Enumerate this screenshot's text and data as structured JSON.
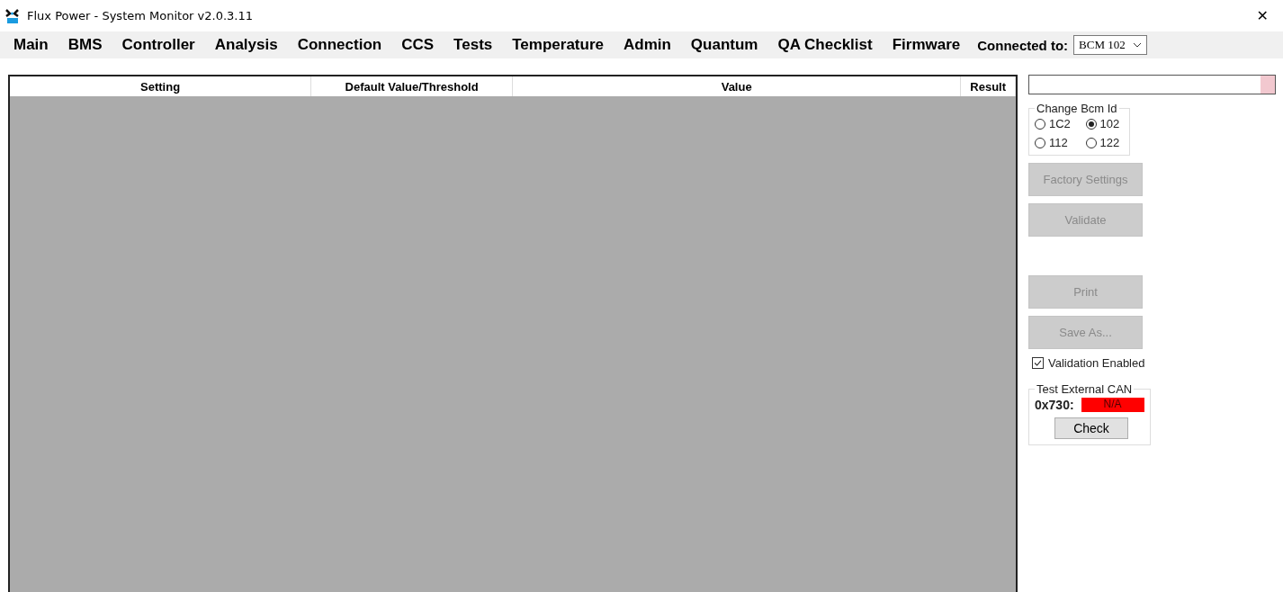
{
  "window": {
    "title": "Flux Power - System Monitor v2.0.3.11",
    "close": "✕"
  },
  "menu": [
    {
      "label": "Main"
    },
    {
      "label": "BMS"
    },
    {
      "label": "Controller"
    },
    {
      "label": "Analysis"
    },
    {
      "label": "Connection"
    },
    {
      "label": "CCS"
    },
    {
      "label": "Tests"
    },
    {
      "label": "Temperature"
    },
    {
      "label": "Admin"
    },
    {
      "label": "Quantum"
    },
    {
      "label": "QA Checklist"
    },
    {
      "label": "Firmware"
    }
  ],
  "connection": {
    "label": "Connected to:",
    "value": "BCM 102"
  },
  "table": {
    "columns": [
      "Setting",
      "Default Value/Threshold",
      "Value",
      "Result"
    ]
  },
  "side": {
    "change_bcm": {
      "title": "Change Bcm Id",
      "options": [
        {
          "label": "1C2",
          "selected": false
        },
        {
          "label": "102",
          "selected": true
        },
        {
          "label": "112",
          "selected": false
        },
        {
          "label": "122",
          "selected": false
        }
      ]
    },
    "buttons_top": [
      {
        "label": "Factory Settings",
        "disabled": true
      },
      {
        "label": "Validate",
        "disabled": true
      }
    ],
    "buttons_bottom": [
      {
        "label": "Print",
        "disabled": true
      },
      {
        "label": "Save As...",
        "disabled": true
      }
    ],
    "validation": {
      "label": "Validation Enabled",
      "checked": true
    },
    "can_test": {
      "title": "Test External CAN",
      "address": "0x730:",
      "status": "N/A",
      "color": "#ff0000",
      "button": {
        "label": "Check",
        "disabled": false
      }
    }
  }
}
